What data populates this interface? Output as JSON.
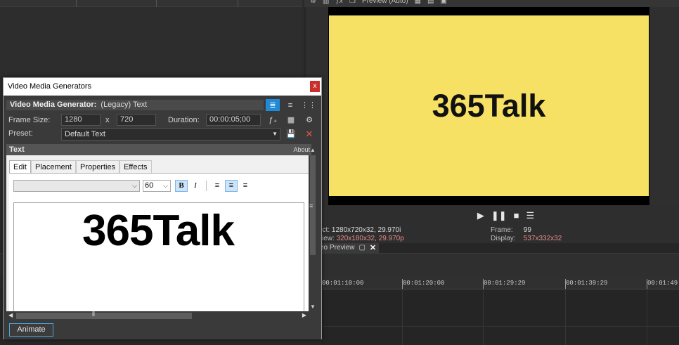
{
  "preview_toolbar": {
    "mode_label": "Preview (Auto)",
    "icons": [
      "gear-icon",
      "split-icon",
      "fx-icon",
      "copy-icon",
      "grid-icon",
      "save-icon",
      "disk-icon"
    ]
  },
  "preview": {
    "frame_text": "365Talk",
    "frame_color": "#f7e164",
    "transport": [
      "play-icon",
      "pause-icon",
      "stop-icon",
      "menu-icon"
    ],
    "project_label": "ect:",
    "project_value": "1280x720x32, 29.970i",
    "preview_label": "view:",
    "preview_value": "320x180x32, 29.970p",
    "frame_label": "Frame:",
    "frame_value": "99",
    "display_label": "Display:",
    "display_value": "537x332x32",
    "tab_label": "eo Preview",
    "highlight_color": "#e58a8a"
  },
  "ruler": {
    "labels": [
      "0",
      "00:01:10:00",
      "00:01:20:00",
      "00:01:29:29",
      "00:01:39:29",
      "00:01:49:2"
    ]
  },
  "dialog": {
    "title": "Video Media Generators",
    "close_label": "x",
    "generator_label": "Video Media Generator:",
    "generator_value": "(Legacy) Text",
    "frame_size_label": "Frame Size:",
    "width": "1280",
    "x_label": "x",
    "height": "720",
    "duration_label": "Duration:",
    "duration": "00:00:05;00",
    "preset_label": "Preset:",
    "preset_value": "Default Text",
    "panel_title": "Text",
    "about_label": "About",
    "tabs": [
      "Edit",
      "Placement",
      "Properties",
      "Effects"
    ],
    "font_size": "60",
    "bold_label": "B",
    "italic_label": "I",
    "edit_text": "365Talk",
    "animate_label": "Animate",
    "accent_color": "#1f8ad8"
  }
}
